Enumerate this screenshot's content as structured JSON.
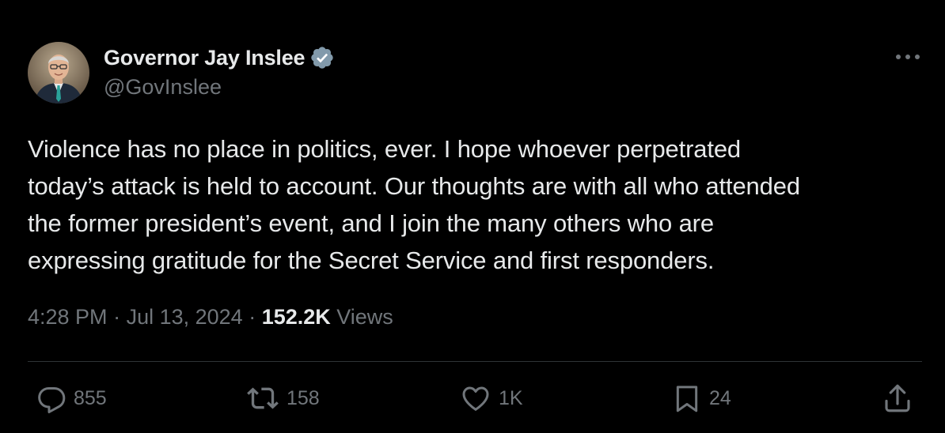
{
  "author": {
    "display_name": "Governor Jay Inslee",
    "handle": "@GovInslee",
    "verified_icon": "verified-badge-icon",
    "avatar": "avatar-photo"
  },
  "tweet": {
    "text": "Violence has no place in politics, ever. I hope whoever perpetrated\ntoday’s attack is held to account. Our thoughts are with all who attended\nthe former president’s event, and I join the many others who are\nexpressing gratitude for the Secret Service and first responders."
  },
  "meta": {
    "time": "4:28 PM",
    "separator": " · ",
    "date": "Jul 13, 2024",
    "views_count": "152.2K",
    "views_label": " Views"
  },
  "actions": {
    "replies": {
      "icon": "reply-icon",
      "count": "855"
    },
    "reposts": {
      "icon": "repost-icon",
      "count": "158"
    },
    "likes": {
      "icon": "heart-icon",
      "count": "1K"
    },
    "bookmarks": {
      "icon": "bookmark-icon",
      "count": "24"
    },
    "share": {
      "icon": "share-icon"
    }
  },
  "colors": {
    "background": "#000000",
    "primary_text": "#e7e9ea",
    "secondary_text": "#71767b",
    "divider": "#2f3336",
    "verified_badge": "#829aab"
  }
}
